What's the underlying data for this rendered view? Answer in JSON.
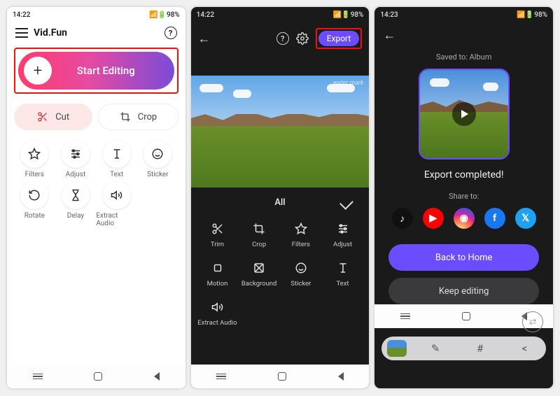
{
  "status": {
    "time_a": "14:22",
    "time_b": "14:23",
    "battery": "98%"
  },
  "p1": {
    "title": "Vid.Fun",
    "start_label": "Start Editing",
    "cut_label": "Cut",
    "crop_label": "Crop",
    "tools": [
      {
        "icon": "star",
        "label": "Filters"
      },
      {
        "icon": "sliders",
        "label": "Adjust"
      },
      {
        "icon": "text",
        "label": "Text"
      },
      {
        "icon": "smile",
        "label": "Sticker"
      },
      {
        "icon": "rotate",
        "label": "Rotate"
      },
      {
        "icon": "hourglass",
        "label": "Delay"
      },
      {
        "icon": "audio",
        "label": "Extract Audio"
      }
    ]
  },
  "p2": {
    "export_label": "Export",
    "watermark": "water mark",
    "all_label": "All",
    "tools": [
      {
        "icon": "trim",
        "label": "Trim"
      },
      {
        "icon": "crop",
        "label": "Crop"
      },
      {
        "icon": "star",
        "label": "Filters"
      },
      {
        "icon": "sliders",
        "label": "Adjust"
      },
      {
        "icon": "motion",
        "label": "Motion"
      },
      {
        "icon": "background",
        "label": "Background"
      },
      {
        "icon": "smile",
        "label": "Sticker"
      },
      {
        "icon": "text",
        "label": "Text"
      },
      {
        "icon": "audio",
        "label": "Extract Audio"
      }
    ]
  },
  "p3": {
    "saved_label": "Saved to: Album",
    "done_label": "Export completed!",
    "share_label": "Share to:",
    "share_targets": [
      "tiktok",
      "youtube",
      "instagram",
      "facebook",
      "twitter"
    ],
    "back_home_label": "Back to Home",
    "keep_editing_label": "Keep editing"
  }
}
